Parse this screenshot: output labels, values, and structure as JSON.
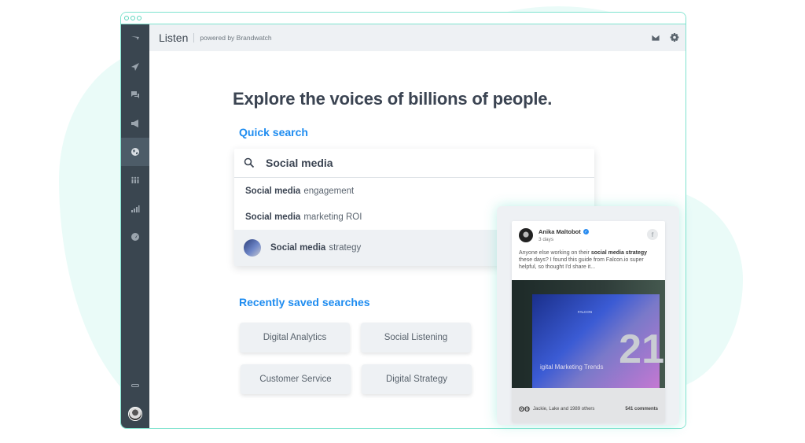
{
  "window": {
    "controls": [
      "dot",
      "dot",
      "dot"
    ]
  },
  "topbar": {
    "title": "Listen",
    "powered_by": "powered by Brandwatch",
    "icons": [
      "mail-icon",
      "gear-icon"
    ]
  },
  "sidebar": {
    "items": [
      {
        "icon": "falcon-logo-icon",
        "active": false
      },
      {
        "icon": "paper-plane-icon",
        "active": false
      },
      {
        "icon": "chat-bubbles-icon",
        "active": false
      },
      {
        "icon": "megaphone-icon",
        "active": false
      },
      {
        "icon": "globe-icon",
        "active": true
      },
      {
        "icon": "people-icon",
        "active": false
      },
      {
        "icon": "bar-chart-icon",
        "active": false
      },
      {
        "icon": "speedometer-icon",
        "active": false
      }
    ],
    "bottom": [
      {
        "icon": "link-icon"
      },
      {
        "icon": "user-avatar"
      }
    ]
  },
  "main": {
    "headline": "Explore the voices of billions of people.",
    "quick_search_label": "Quick search",
    "search": {
      "value": "Social media",
      "suggestions": [
        {
          "bold": "Social media",
          "rest": "engagement"
        },
        {
          "bold": "Social media",
          "rest": "marketing ROI"
        },
        {
          "bold": "Social media",
          "rest": "strategy",
          "highlighted": true
        }
      ]
    },
    "recent_label": "Recently saved searches",
    "saved_searches": [
      "Digital Analytics",
      "Social Listening",
      "Customer Service",
      "Digital Strategy"
    ]
  },
  "post": {
    "author": "Anika Maltobot",
    "verified": "✓",
    "time": "3 days",
    "network_icon": "f",
    "text_before": "Anyone else working on their ",
    "text_bold": "social media strategy",
    "text_after": " these days? I found this guide from Falcon.io super helpful, so thought I'd share it...",
    "image": {
      "brand": "FALCON",
      "number": "21",
      "title": "igital Marketing Trends"
    },
    "reactions_icon": "ʘʘ",
    "reactions": "Jackie, Lake and 1989 others",
    "comments": "541 comments"
  },
  "colors": {
    "accent_blue": "#1e8cf0",
    "sidebar_bg": "#3a4650",
    "window_border": "#7fe3cf",
    "blob": "#eafbf8"
  }
}
